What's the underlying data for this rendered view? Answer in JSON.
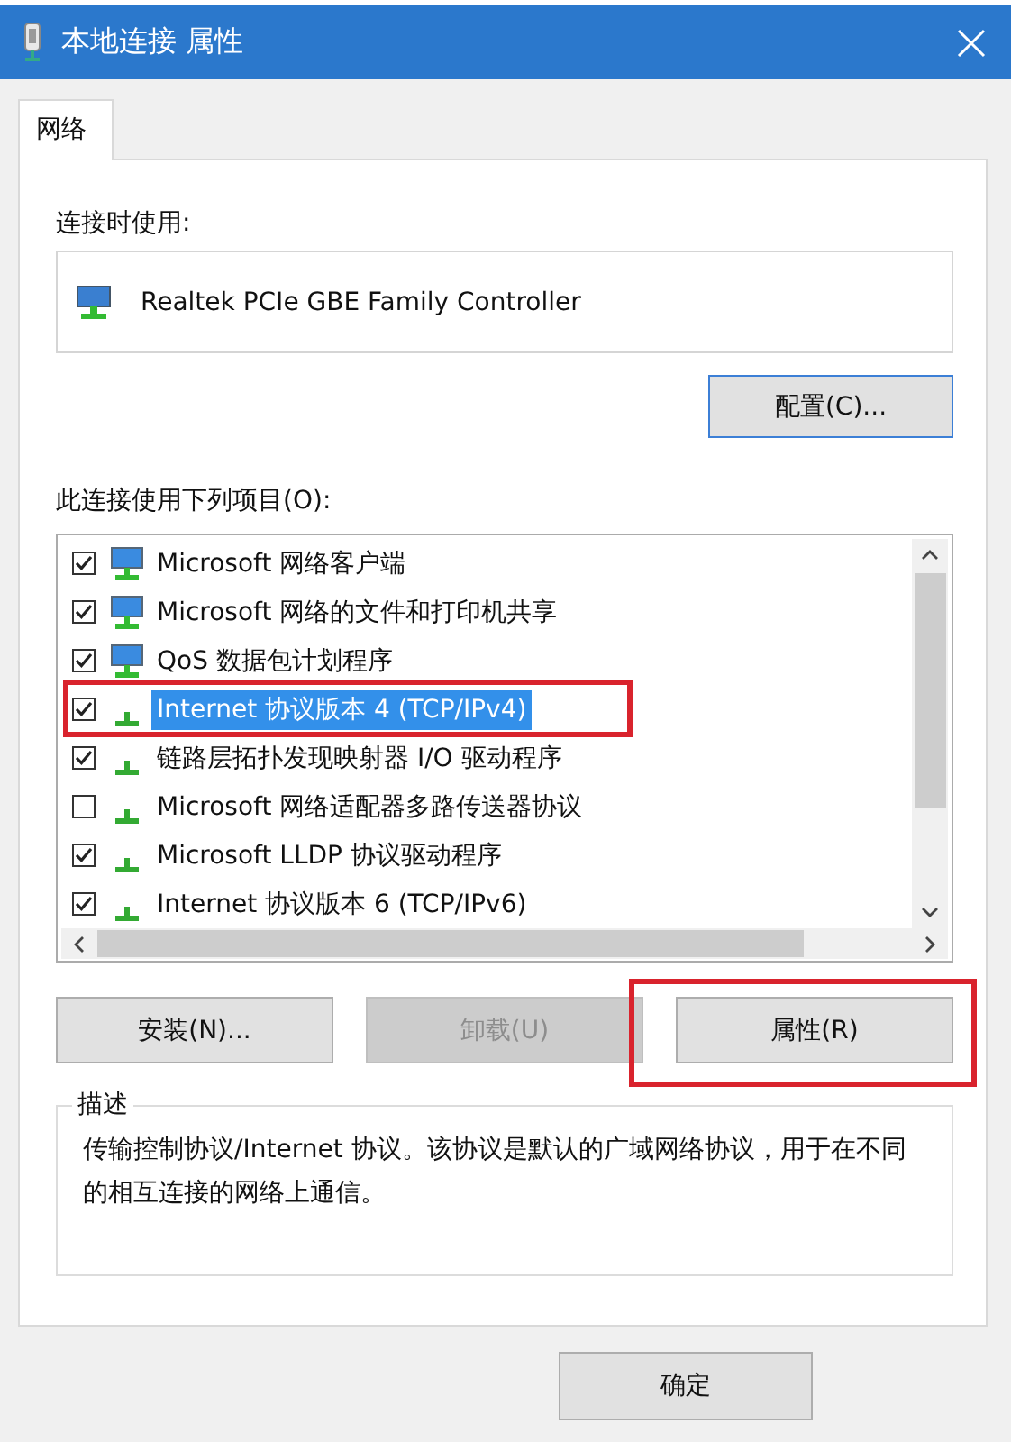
{
  "window": {
    "title": "本地连接 属性"
  },
  "tabs": [
    {
      "label": "网络",
      "selected": true
    }
  ],
  "connect_using": {
    "label": "连接时使用:",
    "adapter": "Realtek PCIe GBE Family Controller",
    "configure_button": "配置(C)..."
  },
  "items_label": "此连接使用下列项目(O):",
  "items": [
    {
      "label": "Microsoft 网络客户端",
      "kind": "computer",
      "checked": true,
      "selected": false,
      "annotated": false
    },
    {
      "label": "Microsoft 网络的文件和打印机共享",
      "kind": "computer",
      "checked": true,
      "selected": false,
      "annotated": false
    },
    {
      "label": "QoS 数据包计划程序",
      "kind": "computer",
      "checked": true,
      "selected": false,
      "annotated": false
    },
    {
      "label": "Internet 协议版本 4 (TCP/IPv4)",
      "kind": "protocol",
      "checked": true,
      "selected": true,
      "annotated": true
    },
    {
      "label": "链路层拓扑发现映射器 I/O 驱动程序",
      "kind": "protocol",
      "checked": true,
      "selected": false,
      "annotated": false
    },
    {
      "label": "Microsoft 网络适配器多路传送器协议",
      "kind": "protocol",
      "checked": false,
      "selected": false,
      "annotated": false
    },
    {
      "label": "Microsoft LLDP 协议驱动程序",
      "kind": "protocol",
      "checked": true,
      "selected": false,
      "annotated": false
    },
    {
      "label": "Internet 协议版本 6 (TCP/IPv6)",
      "kind": "protocol",
      "checked": true,
      "selected": false,
      "annotated": false
    }
  ],
  "action_buttons": [
    {
      "label": "安装(N)...",
      "disabled": false,
      "annotated": false
    },
    {
      "label": "卸载(U)",
      "disabled": true,
      "annotated": false
    },
    {
      "label": "属性(R)",
      "disabled": false,
      "annotated": true
    }
  ],
  "description": {
    "legend": "描述",
    "text": "传输控制协议/Internet 协议。该协议是默认的广域网络协议，用于在不同的相互连接的网络上通信。"
  },
  "footer_buttons": [
    "确定"
  ]
}
